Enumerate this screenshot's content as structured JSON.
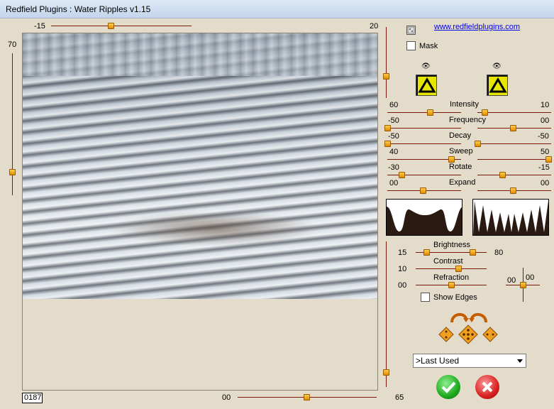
{
  "window": {
    "title": "Redfield Plugins : Water Ripples v1.15"
  },
  "preview_sliders": {
    "top_value": "-15",
    "top_right_value": "20",
    "left_value": "70",
    "bottom_value": "00",
    "bottom_right_value": "65",
    "frame_counter": "0187"
  },
  "header": {
    "link_text": "www.redfieldplugins.com",
    "mask_label": "Mask"
  },
  "params": [
    {
      "name": "Intensity",
      "left": "60",
      "right": "10"
    },
    {
      "name": "Frequency",
      "left": "-50",
      "right": "00"
    },
    {
      "name": "Decay",
      "left": "-50",
      "right": "-50"
    },
    {
      "name": "Sweep",
      "left": "40",
      "right": "50"
    },
    {
      "name": "Rotate",
      "left": "-30",
      "right": "-15"
    },
    {
      "name": "Expand",
      "left": "00",
      "right": "00"
    }
  ],
  "adjust": {
    "brightness_label": "Brightness",
    "brightness_left": "15",
    "brightness_right": "80",
    "contrast_label": "Contrast",
    "contrast_value": "10",
    "refraction_label": "Refraction",
    "refraction_value": "00",
    "offset_x": "00",
    "offset_y": "00",
    "show_edges_label": "Show Edges"
  },
  "preset": {
    "selected": ">Last Used"
  },
  "colors": {
    "accent": "#e08a00",
    "track": "#7a1a06",
    "ok": "#1faa1f",
    "cancel": "#d92020"
  }
}
